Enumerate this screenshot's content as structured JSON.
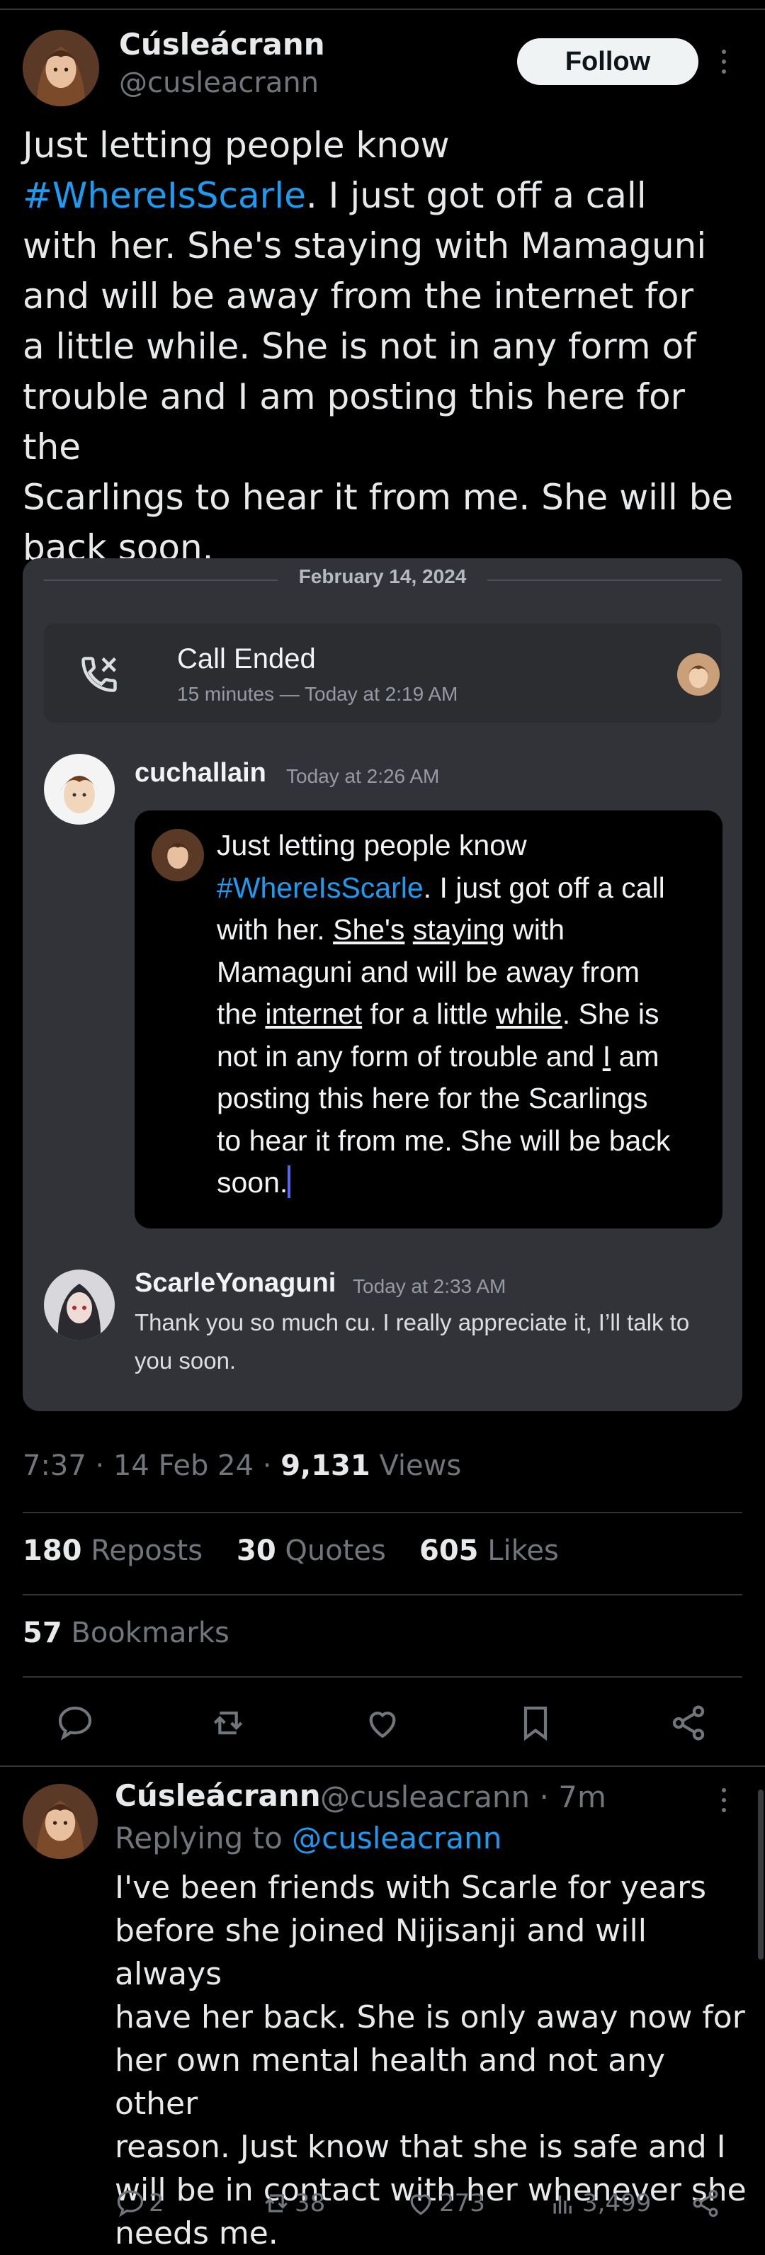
{
  "colors": {
    "accent": "#1d9bf0",
    "background": "#000000",
    "text": "#e7e9ea",
    "muted": "#71767b",
    "discord_bg": "#313338"
  },
  "post": {
    "author_name": "Cúsleácrann",
    "author_handle": "@cusleacrann",
    "follow_label": "Follow",
    "text_before": "Just letting people know\n",
    "hashtag": "#WhereIsScarle",
    "text_after": ". I just got off a call\nwith her. She's staying with Mamaguni\nand will be away from the internet for\na little while. She is not in any form of\ntrouble and I am posting this here for the\nScarlings to hear it from me. She will be\nback soon."
  },
  "discord": {
    "date": "February 14, 2024",
    "call_title": "Call Ended",
    "call_subtitle": "15 minutes — Today at 2:19 AM",
    "msg1_author": "cuchallain",
    "msg1_time": "Today at 2:26 AM",
    "quote_l1": "Just letting people know",
    "quote_hashtag": "#WhereIsScarle",
    "quote_l2": ". I just got off a call",
    "quote_l3a": "with her. ",
    "quote_w_shes": "She's",
    "quote_w_staying": "staying",
    "quote_l3b": " with",
    "quote_l4": "Mamaguni and will be away from",
    "quote_l5a": "the ",
    "quote_w_internet": "internet",
    "quote_l5b": " for a little ",
    "quote_w_while": "while",
    "quote_l5c": ". She is",
    "quote_l6a": "not in any form of trouble and ",
    "quote_w_i": "I",
    "quote_l6b": " am",
    "quote_l7": "posting this here for the Scarlings",
    "quote_l8": "to hear it from me. She will be back",
    "quote_l9": "soon.",
    "msg2_author": "ScarleYonaguni",
    "msg2_time": "Today at 2:33 AM",
    "msg2_text": "Thank you so much cu. I really appreciate it, I’ll talk to you soon."
  },
  "meta": {
    "time": "7:37",
    "dot1": " · ",
    "date": "14 Feb 24",
    "dot2": " · ",
    "views_count": "9,131",
    "views_label": " Views"
  },
  "stats": {
    "reposts_count": "180",
    "reposts_label": " Reposts",
    "quotes_count": "30",
    "quotes_label": " Quotes",
    "likes_count": "605",
    "likes_label": " Likes",
    "bookmarks_count": "57",
    "bookmarks_label": " Bookmarks"
  },
  "actions": [
    "reply-icon",
    "repost-icon",
    "like-icon",
    "bookmark-icon",
    "share-icon"
  ],
  "reply": {
    "author_name": "Cúsleácrann",
    "author_handle": "@cusleacrann · 7m",
    "replying_prefix": "Replying to ",
    "replying_handle": "@cusleacrann",
    "text": "I've been friends with Scarle for years\nbefore she joined Nijisanji and will always\nhave her back. She is only away now for\nher own mental health and not any other\nreason. Just know that she is safe and I\nwill be in contact with her whenever she\nneeds me.",
    "replies": "2",
    "reposts": "38",
    "likes": "273",
    "views": "3,499"
  }
}
